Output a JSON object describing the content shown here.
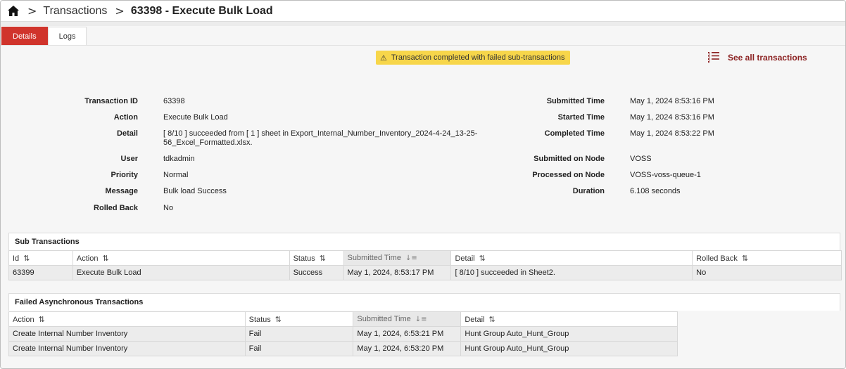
{
  "breadcrumb": {
    "home_icon": "home-icon",
    "separator": ">",
    "parent": "Transactions",
    "current": "63398 - Execute Bulk Load"
  },
  "tabs": [
    {
      "label": "Details",
      "active": true
    },
    {
      "label": "Logs",
      "active": false
    }
  ],
  "warning": {
    "icon": "warning-icon",
    "text": "Transaction completed with failed sub-transactions"
  },
  "see_all": {
    "icon": "list-icon",
    "label": "See all transactions"
  },
  "details_left": [
    {
      "label": "Transaction ID",
      "value": "63398"
    },
    {
      "label": "Action",
      "value": "Execute Bulk Load"
    },
    {
      "label": "Detail",
      "value": "[ 8/10 ] succeeded from [ 1 ] sheet in Export_Internal_Number_Inventory_2024-4-24_13-25-",
      "value2": "56_Excel_Formatted.xlsx."
    },
    {
      "label": "User",
      "value": "tdkadmin"
    },
    {
      "label": "Priority",
      "value": "Normal"
    },
    {
      "label": "Message",
      "value": "Bulk load Success"
    },
    {
      "label": "Rolled Back",
      "value": "No"
    }
  ],
  "details_right": [
    {
      "label": "Submitted Time",
      "value": "May 1, 2024 8:53:16 PM"
    },
    {
      "label": "Started Time",
      "value": "May 1, 2024 8:53:16 PM"
    },
    {
      "label": "Completed Time",
      "value": "May 1, 2024 8:53:22 PM"
    },
    {
      "label": "Submitted on Node",
      "value": "VOSS"
    },
    {
      "label": "Processed on Node",
      "value": "VOSS-voss-queue-1"
    },
    {
      "label": "Duration",
      "value": "6.108 seconds"
    }
  ],
  "sub_transactions": {
    "title": "Sub Transactions",
    "columns": [
      "Id",
      "Action",
      "Status",
      "Submitted Time",
      "Detail",
      "Rolled Back"
    ],
    "rows": [
      [
        "63399",
        "Execute Bulk Load",
        "Success",
        "May 1, 2024, 8:53:17 PM",
        "[ 8/10 ] succeeded in Sheet2.",
        "No"
      ]
    ]
  },
  "failed_async": {
    "title": "Failed Asynchronous Transactions",
    "columns": [
      "Action",
      "Status",
      "Submitted Time",
      "Detail"
    ],
    "rows": [
      [
        "Create Internal Number Inventory",
        "Fail",
        "May 1, 2024, 6:53:21 PM",
        "Hunt Group Auto_Hunt_Group"
      ],
      [
        "Create Internal Number Inventory",
        "Fail",
        "May 1, 2024, 6:53:20 PM",
        "Hunt Group Auto_Hunt_Group"
      ]
    ]
  },
  "colors": {
    "accent": "#d0342c",
    "link": "#8b2121",
    "warning_bg": "#f7d64a"
  }
}
